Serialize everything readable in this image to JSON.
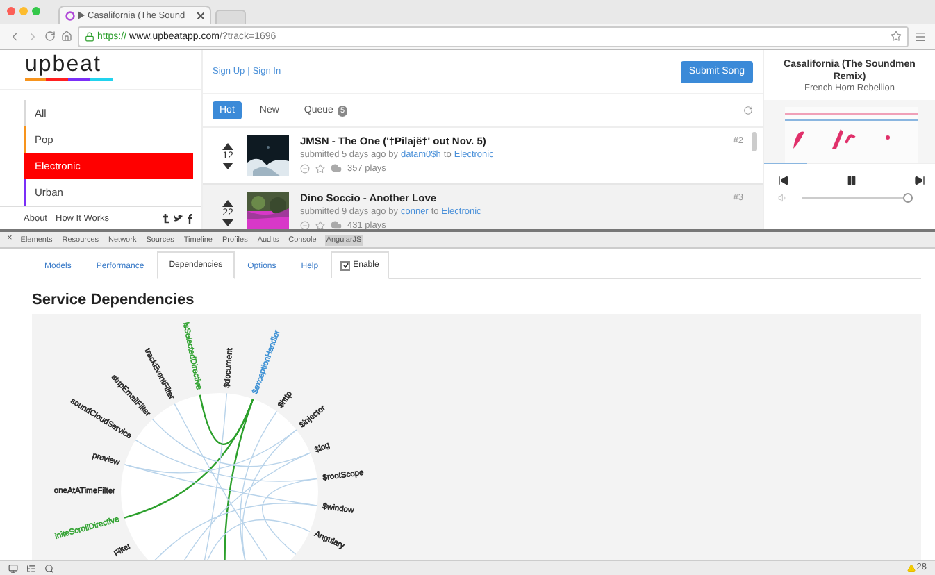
{
  "browser": {
    "tab_title": "Casalifornia (The Sound",
    "url_scheme": "https://",
    "url_host": "www.upbeatapp.com",
    "url_path": "/?track=1696"
  },
  "site": {
    "logo": "upbeat",
    "genres": [
      {
        "label": "All",
        "color": "#d9d9d9",
        "selected": false
      },
      {
        "label": "Pop",
        "color": "#f7941d",
        "selected": false
      },
      {
        "label": "Electronic",
        "color": "#ff0000",
        "selected": true
      },
      {
        "label": "Urban",
        "color": "#7b2ff7",
        "selected": false
      }
    ],
    "footer_links": [
      "About",
      "How It Works"
    ],
    "auth": {
      "sign_up": "Sign Up",
      "separator": "|",
      "sign_in": "Sign In"
    },
    "submit_button": "Submit Song",
    "feed_tabs": [
      {
        "label": "Hot",
        "selected": true
      },
      {
        "label": "New",
        "selected": false
      },
      {
        "label": "Queue",
        "selected": false,
        "badge": "5"
      }
    ],
    "tracks": [
      {
        "votes": "12",
        "title": "JMSN - The One ('†Pilajë†' out Nov. 5)",
        "submitted": "submitted 5 days ago by",
        "user": "datam0$h",
        "to": "to",
        "genre": "Electronic",
        "plays": "357 plays",
        "rank": "#2",
        "highlighted": false
      },
      {
        "votes": "22",
        "title": "Dino Soccio - Another Love",
        "submitted": "submitted 9 days ago by",
        "user": "conner",
        "to": "to",
        "genre": "Electronic",
        "plays": "431 plays",
        "rank": "#3",
        "highlighted": true
      }
    ]
  },
  "player": {
    "title": "Casalifornia (The Soundmen Remix)",
    "artist": "French Horn Rebellion",
    "playing": true,
    "progress": {
      "level": 0.25
    },
    "volume": {
      "level": 0.95
    }
  },
  "devtools": {
    "close": "×",
    "tabs": [
      {
        "label": "Elements",
        "selected": false
      },
      {
        "label": "Resources",
        "selected": false
      },
      {
        "label": "Network",
        "selected": false
      },
      {
        "label": "Sources",
        "selected": false
      },
      {
        "label": "Timeline",
        "selected": false
      },
      {
        "label": "Profiles",
        "selected": false
      },
      {
        "label": "Audits",
        "selected": false
      },
      {
        "label": "Console",
        "selected": false
      },
      {
        "label": "AngularJS",
        "selected": true
      }
    ],
    "panel_tabs": [
      {
        "label": "Models",
        "selected": false
      },
      {
        "label": "Performance",
        "selected": false
      },
      {
        "label": "Dependencies",
        "selected": true
      },
      {
        "label": "Options",
        "selected": false
      },
      {
        "label": "Help",
        "selected": false
      }
    ],
    "enable": {
      "label": "Enable",
      "checked": true
    },
    "heading": "Service Dependencies",
    "graph": {
      "nodes": [
        {
          "label": "Filter",
          "color": "#222222"
        },
        {
          "label": "initeScrollDirective",
          "color": "#2ca02c"
        },
        {
          "label": "oneAtATimeFilter",
          "color": "#222222"
        },
        {
          "label": "preview",
          "color": "#222222"
        },
        {
          "label": "soundCloudService",
          "color": "#222222"
        },
        {
          "label": "stripEmailFilter",
          "color": "#222222"
        },
        {
          "label": "trackEventFilter",
          "color": "#222222"
        },
        {
          "label": "isSelectedDirective",
          "color": "#2ca02c"
        },
        {
          "label": "$document",
          "color": "#222222"
        },
        {
          "label": "$exceptionHandler",
          "color": "#3a8fd4"
        },
        {
          "label": "$http",
          "color": "#222222"
        },
        {
          "label": "$injector",
          "color": "#222222"
        },
        {
          "label": "$log",
          "color": "#222222"
        },
        {
          "label": "$rootScope",
          "color": "#222222"
        },
        {
          "label": "$window",
          "color": "#222222"
        },
        {
          "label": "Angulary",
          "color": "#222222"
        }
      ]
    },
    "warnings": "28"
  }
}
